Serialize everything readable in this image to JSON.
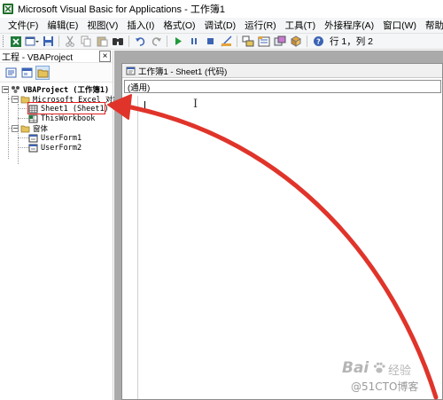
{
  "window": {
    "title": "Microsoft Visual Basic for Applications - 工作簿1"
  },
  "menu": {
    "items": [
      "文件(F)",
      "编辑(E)",
      "视图(V)",
      "插入(I)",
      "格式(O)",
      "调试(D)",
      "运行(R)",
      "工具(T)",
      "外接程序(A)",
      "窗口(W)",
      "帮助(H)"
    ]
  },
  "toolbar": {
    "position_text": "行 1，列 2",
    "icons": [
      "excel-icon",
      "insert-userform-icon",
      "save-icon",
      "cut-icon",
      "copy-icon",
      "paste-icon",
      "find-icon",
      "undo-icon",
      "redo-icon",
      "run-icon",
      "break-icon",
      "reset-icon",
      "design-mode-icon",
      "project-explorer-icon",
      "properties-icon",
      "object-browser-icon",
      "toolbox-icon",
      "help-icon"
    ]
  },
  "project_pane": {
    "title": "工程 - VBAProject",
    "close_label": "×",
    "tree": {
      "root": "VBAProject (工作簿1)",
      "folder_excel": "Microsoft Excel 对象",
      "sheet1": "Sheet1 (Sheet1)",
      "thisworkbook": "ThisWorkbook",
      "folder_forms": "窗体",
      "userform1": "UserForm1",
      "userform2": "UserForm2"
    }
  },
  "code_window": {
    "title": "工作簿1 - Sheet1 (代码)",
    "object_dropdown": "(通用)"
  },
  "watermark": {
    "brand": "Bai",
    "brand_suffix": "经验",
    "credit": "@51CTO博客"
  },
  "colors": {
    "arrow": "#e0342a",
    "highlight_box": "#e02020",
    "mdi_background": "#aaaaaa"
  }
}
